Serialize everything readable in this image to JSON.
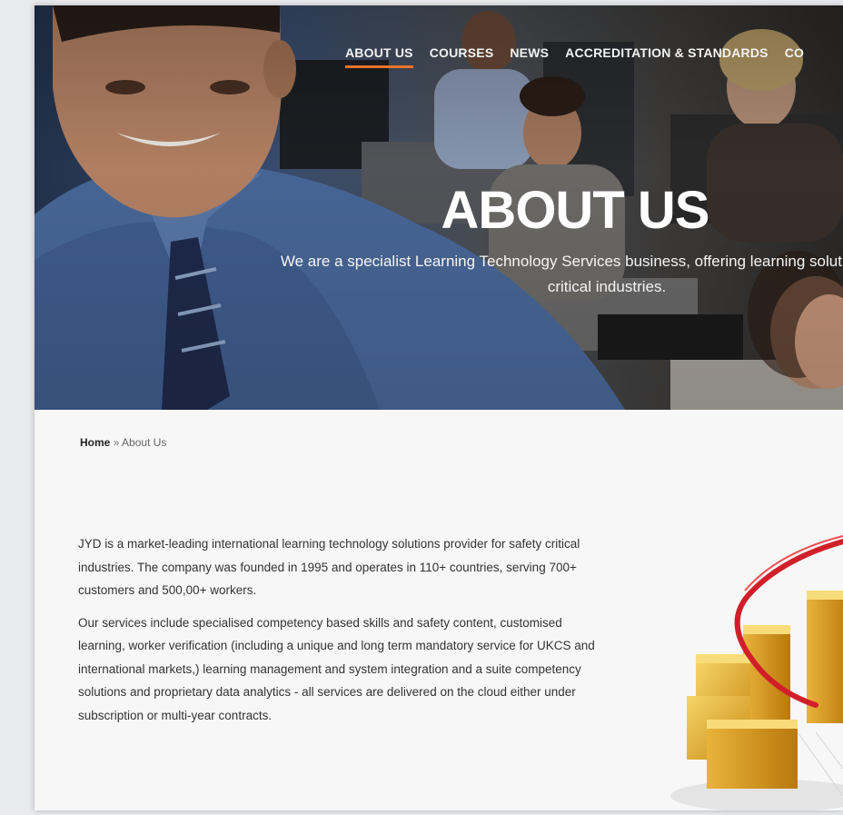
{
  "nav": {
    "items": [
      "ABOUT US",
      "COURSES",
      "NEWS",
      "ACCREDITATION & STANDARDS",
      "CO"
    ],
    "active_index": 0
  },
  "hero": {
    "title": "ABOUT US",
    "subtitle": "We are a specialist Learning Technology Services business, offering learning solutions to safety critical industries."
  },
  "breadcrumb": {
    "home": "Home",
    "separator": "»",
    "current": "About Us"
  },
  "content": {
    "paragraph_1": "JYD is a market-leading international learning technology solutions provider for safety critical industries. The company was founded in 1995 and operates in 110+ countries, serving 700+ customers and 500,00+ workers.",
    "paragraph_2": "Our services include specialised competency based skills and safety content, customised learning, worker verification (including a unique and long term mandatory service for UKCS and international markets,) learning management and system integration and a suite competency solutions and proprietary data analytics - all services are delivered on the cloud either under subscription or multi-year contracts."
  },
  "colors": {
    "accent": "#e8732a",
    "ribbon": "#d11f2a",
    "gold": "#e0a828"
  }
}
